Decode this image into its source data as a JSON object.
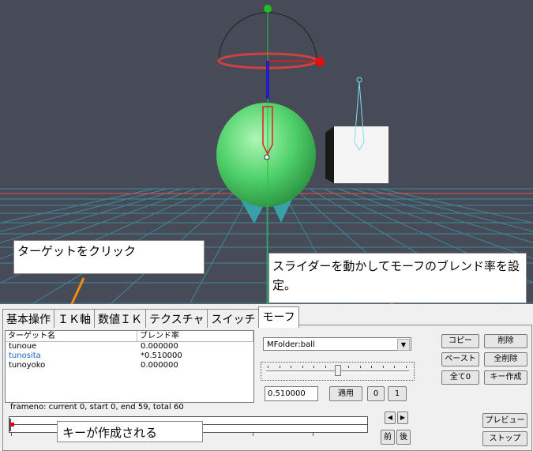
{
  "callouts": {
    "target": "ターゲットをクリック",
    "slider": "スライダーを動かしてモーフのブレンド率を設定。",
    "key": "キーが作成される"
  },
  "tabs": [
    {
      "label": "基本操作",
      "active": false
    },
    {
      "label": "ＩＫ軸",
      "active": false
    },
    {
      "label": "数値ＩＫ",
      "active": false
    },
    {
      "label": "テクスチャ",
      "active": false
    },
    {
      "label": "スイッチ",
      "active": false
    },
    {
      "label": "モーフ",
      "active": true
    }
  ],
  "target_list": {
    "headers": [
      "ターゲット名",
      "ブレンド率"
    ],
    "rows": [
      {
        "name": "tunoue",
        "rate": "0.000000",
        "selected": false
      },
      {
        "name": "tunosita",
        "rate": "*0.510000",
        "selected": true
      },
      {
        "name": "tunoyoko",
        "rate": "0.000000",
        "selected": false
      }
    ]
  },
  "morph_select": {
    "value": "MFolder:ball",
    "arrow": "▼"
  },
  "slider": {
    "value": 0.51
  },
  "value_input": "0.510000",
  "buttons": {
    "apply": "適用",
    "zero": "0",
    "one": "1",
    "copy": "コピー",
    "delete": "削除",
    "paste": "ペースト",
    "delete_all": "全削除",
    "all_zero": "全て0",
    "create_key": "キー作成",
    "nav_left": "◀",
    "nav_right": "▶",
    "prev": "前",
    "next": "後",
    "preview": "プレビュー",
    "stop": "ストップ"
  },
  "frame_info": "frameno: current 0, start 0, end 59, total 60",
  "timeline": {
    "current": 0,
    "start": 0,
    "end": 59,
    "total": 60,
    "key_frames": [
      0
    ]
  },
  "colors": {
    "viewport_bg": "#474b57",
    "grid": "#3f8fa0",
    "ball": "#4fd16a",
    "arrow": "#f08a10",
    "key_marker": "#e00000",
    "selected_text": "#1464c8"
  }
}
